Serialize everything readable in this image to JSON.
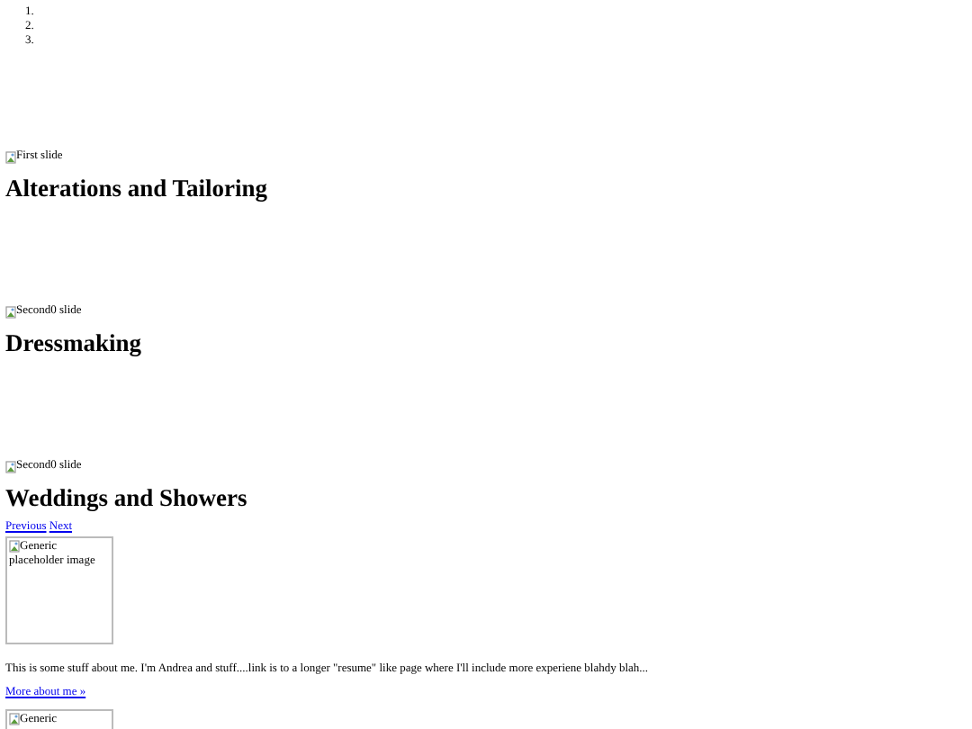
{
  "carousel": {
    "indicators": [
      "1.",
      "2.",
      "3."
    ],
    "slides": [
      {
        "image_alt": "First slide",
        "caption": "Alterations and Tailoring"
      },
      {
        "image_alt": "Second0 slide",
        "caption": "Dressmaking"
      },
      {
        "image_alt": "Second0 slide",
        "caption": "Weddings and Showers"
      }
    ],
    "controls": [
      "Previous",
      "Next"
    ]
  },
  "about": {
    "image_alt": "Generic placeholder image",
    "text": "This is some stuff about me. I'm Andrea and stuff....link is to a longer \"resume\" like page where I'll include more experiene blahdy blah...",
    "link": "More about me »"
  },
  "next_image": {
    "image_alt": "Generic"
  }
}
